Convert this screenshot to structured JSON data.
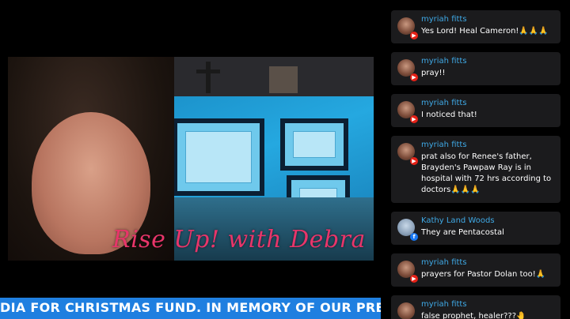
{
  "video": {
    "overlay_title": "Rise Up! with Debra"
  },
  "ticker": {
    "text": "DIA FOR CHRISTMAS FUND.  IN MEMORY OF OUR PRECIOUS \"BABY"
  },
  "chat": {
    "messages": [
      {
        "author": "myriah fitts",
        "text": "Yes Lord! Heal Cameron!🙏🙏🙏",
        "source": "youtube"
      },
      {
        "author": "myriah fitts",
        "text": "pray!!",
        "source": "youtube"
      },
      {
        "author": "myriah fitts",
        "text": "I noticed that!",
        "source": "youtube"
      },
      {
        "author": "myriah fitts",
        "text": "prat also for Renee's father, Brayden's Pawpaw Ray is in hospital with 72 hrs according to doctors🙏🙏🙏",
        "source": "youtube"
      },
      {
        "author": "Kathy Land Woods",
        "text": "They are Pentacostal",
        "source": "facebook"
      },
      {
        "author": "myriah fitts",
        "text": "prayers for Pastor Dolan too!🙏",
        "source": "youtube"
      },
      {
        "author": "myriah fitts",
        "text": "false prophet, healer???🤚",
        "source": "youtube"
      }
    ]
  },
  "colors": {
    "ticker_bg": "#1f7fe0",
    "author_name": "#3fa9e6",
    "overlay_title": "#e8356a"
  }
}
